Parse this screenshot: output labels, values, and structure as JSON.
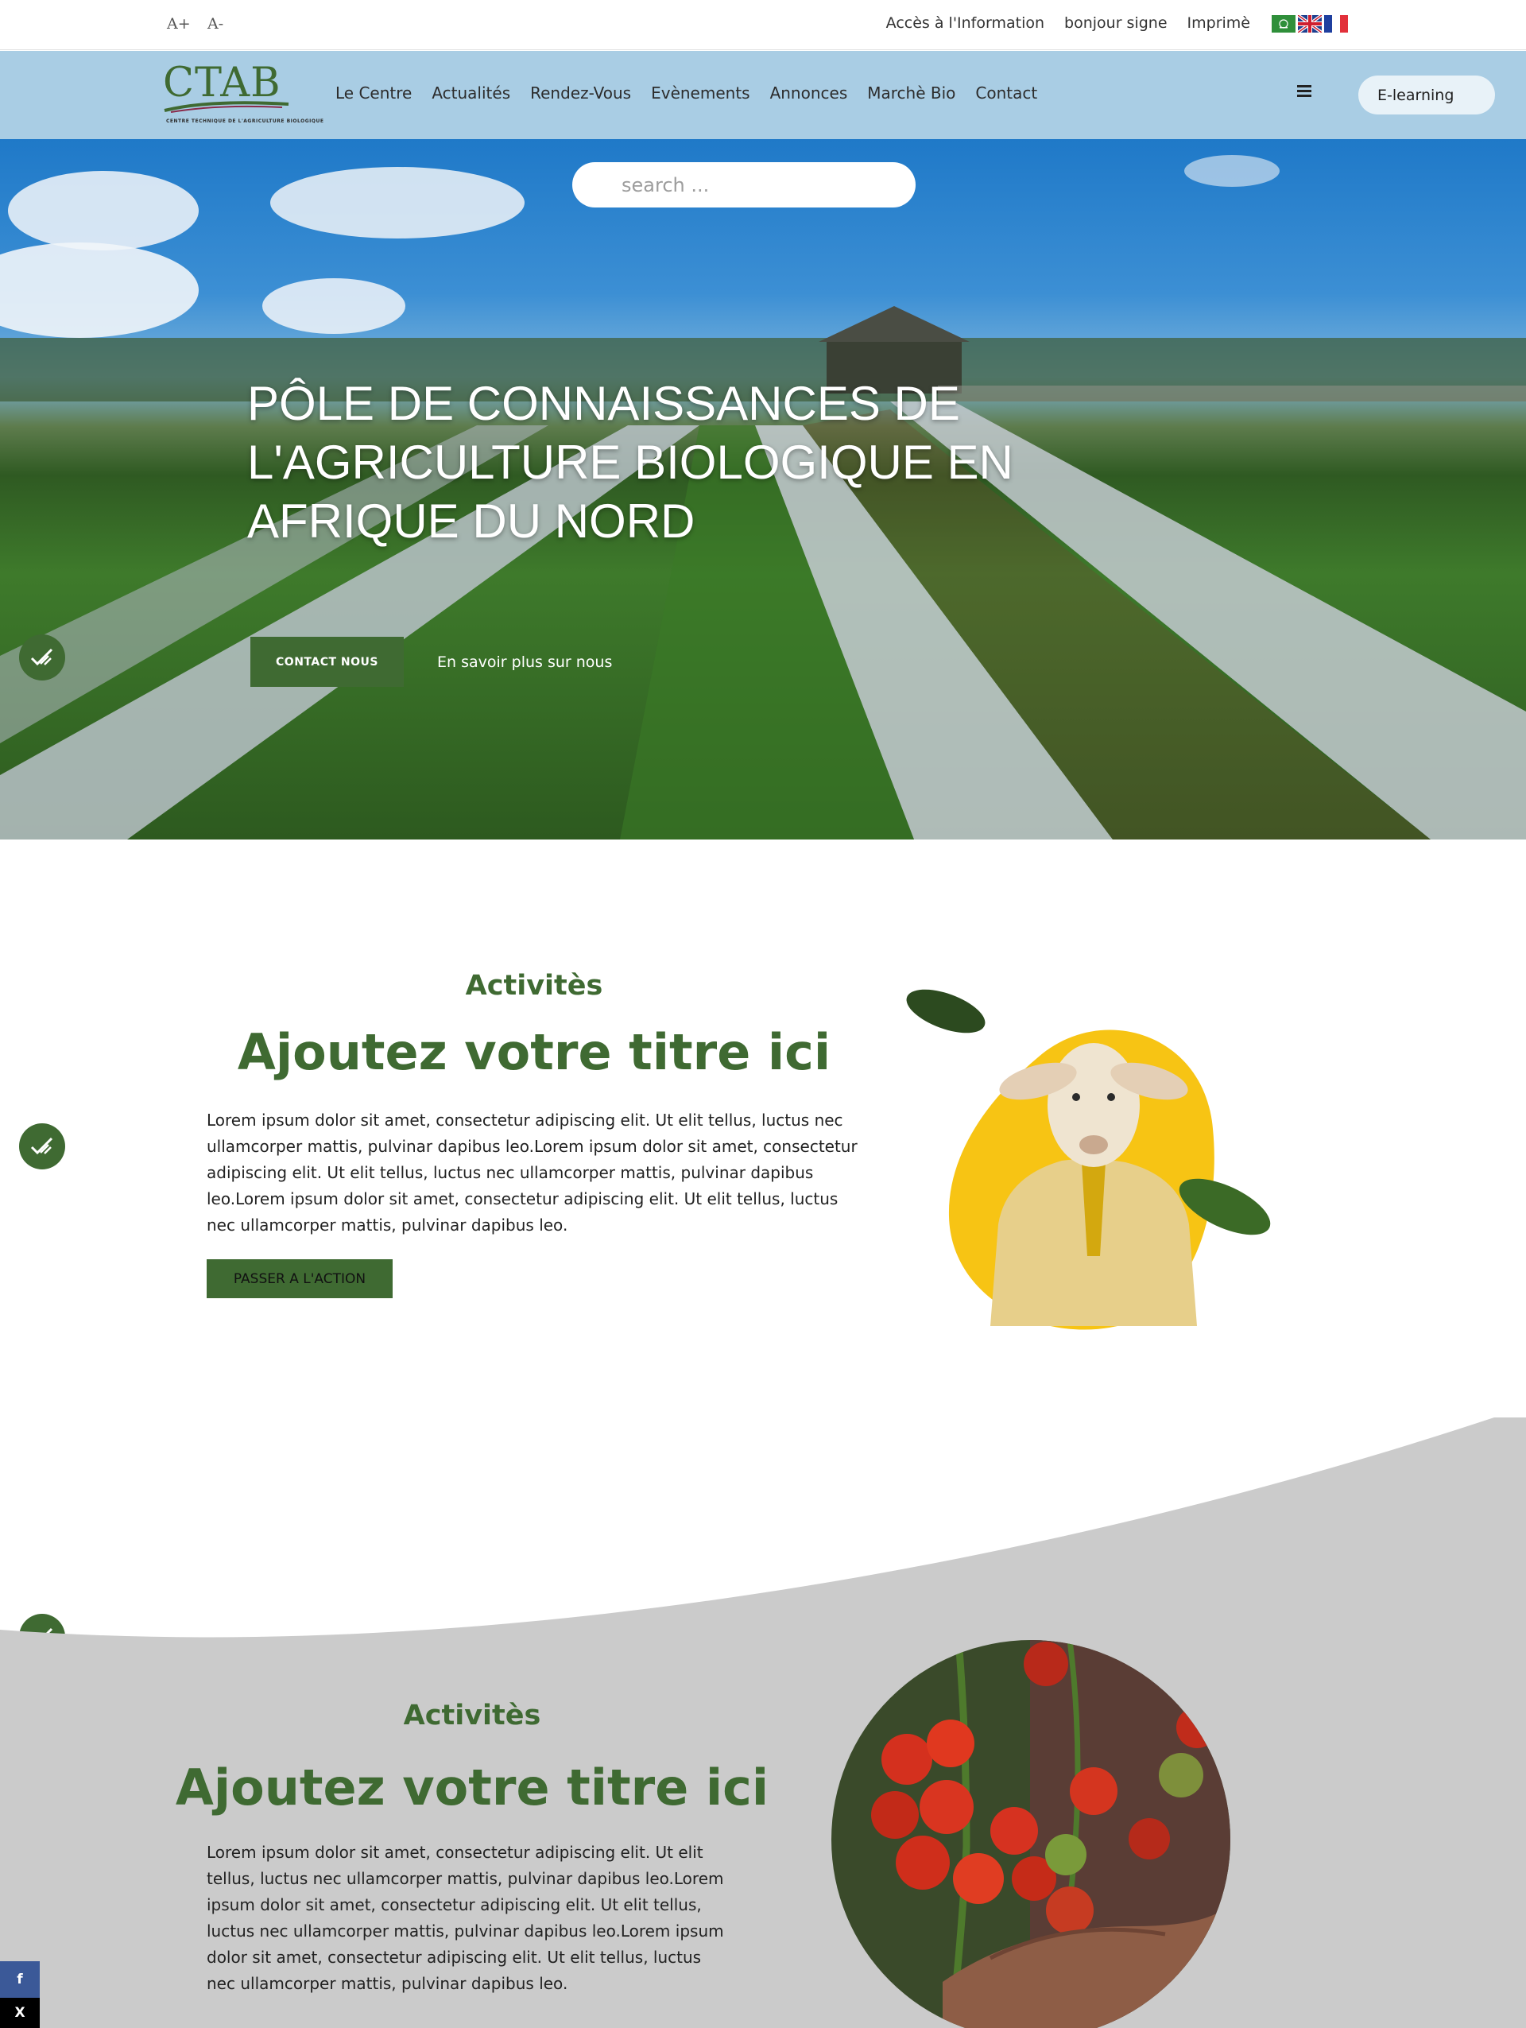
{
  "topbar": {
    "font_increase": "A+",
    "font_decrease": "A-",
    "links": [
      "Accès à l'Information",
      "bonjour signe",
      "Imprimè"
    ],
    "flags": [
      "arabic-flag-icon",
      "english-flag-icon",
      "french-flag-icon"
    ]
  },
  "navbar": {
    "logo_text": "CTAB",
    "logo_tagline": "CENTRE TECHNIQUE DE L'AGRICULTURE BIOLOGIQUE",
    "menu": [
      "Le Centre",
      "Actualités",
      "Rendez-Vous",
      "Evènements",
      "Annonces",
      "Marchè Bio",
      "Contact"
    ],
    "menu_icon": "hamburger-icon",
    "elearning_label": "E-learning"
  },
  "hero": {
    "search_placeholder": "search ...",
    "title": "PÔLE DE CONNAISSANCES DE L'AGRICULTURE BIOLOGIQUE EN AFRIQUE DU NORD",
    "contact_label": "CONTACT NOUS",
    "learn_more_label": "En savoir plus sur nous"
  },
  "section1": {
    "kicker": "Activitès",
    "title": "Ajoutez votre titre ici",
    "text": "Lorem ipsum dolor sit amet, consectetur adipiscing elit. Ut elit tellus, luctus nec ullamcorper mattis, pulvinar dapibus leo.Lorem ipsum dolor sit amet, consectetur adipiscing elit. Ut elit tellus, luctus nec ullamcorper mattis, pulvinar dapibus leo.Lorem ipsum dolor sit amet, consectetur adipiscing elit. Ut elit tellus, luctus nec ullamcorper mattis, pulvinar dapibus leo.",
    "action_label": "PASSER A L'ACTION"
  },
  "section2": {
    "kicker": "Activitès",
    "title": "Ajoutez votre titre ici",
    "text": "Lorem ipsum dolor sit amet, consectetur adipiscing elit. Ut elit tellus, luctus nec ullamcorper mattis, pulvinar dapibus leo.Lorem ipsum dolor sit amet, consectetur adipiscing elit. Ut elit tellus, luctus nec ullamcorper mattis, pulvinar dapibus leo.Lorem ipsum dolor sit amet, consectetur adipiscing elit. Ut elit tellus, luctus nec ullamcorper mattis, pulvinar dapibus leo."
  },
  "social": {
    "facebook": "f",
    "x": "X"
  },
  "colors": {
    "brand_green": "#3f6a32",
    "nav_blue": "#a9cde4",
    "section_grey": "#cbcbcb",
    "facebook": "#3b5998",
    "x": "#000000"
  }
}
